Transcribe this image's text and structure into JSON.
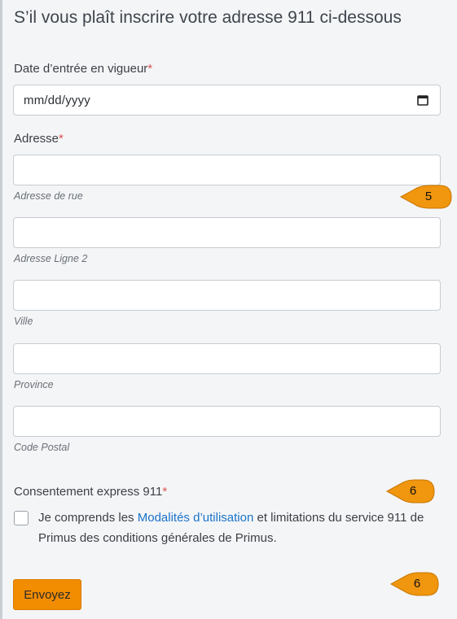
{
  "form": {
    "title": "S’il vous plaît inscrire votre adresse 911 ci-dessous",
    "effective_date": {
      "label": "Date d’entrée en vigueur",
      "required_mark": "*",
      "value": "mm/dd/yyyy"
    },
    "address": {
      "label": "Adresse",
      "required_mark": "*",
      "fields": [
        {
          "help": "Adresse de rue",
          "value": ""
        },
        {
          "help": "Adresse Ligne 2",
          "value": ""
        },
        {
          "help": "Ville",
          "value": ""
        },
        {
          "help": "Province",
          "value": ""
        },
        {
          "help": "Code Postal",
          "value": ""
        }
      ]
    },
    "consent": {
      "label": "Consentement express 911",
      "required_mark": "*",
      "checked": false,
      "text_before": "Je comprends les ",
      "link_text": "Modalités d’utilisation",
      "text_after": " et limitations du service 911 de Primus des conditions générales de Primus."
    },
    "submit_label": "Envoyez"
  },
  "callouts": [
    {
      "number": "5"
    },
    {
      "number": "6"
    },
    {
      "number": "6"
    }
  ],
  "colors": {
    "accent": "#f28c00",
    "callout": "#f0960f",
    "link": "#1a73c9",
    "required": "#d9534f",
    "background": "#f4f5f7"
  },
  "icons": {
    "date": "calendar-icon"
  }
}
